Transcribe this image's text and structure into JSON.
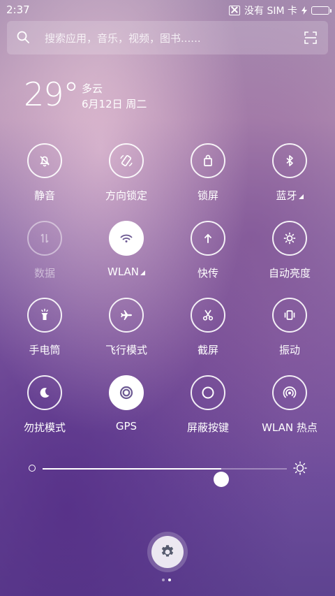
{
  "status": {
    "time": "2:37",
    "carrier": "没有 SIM 卡",
    "battery_percent": 100,
    "battery_color": "#3ddc44"
  },
  "search": {
    "placeholder": "搜索应用，音乐，视频，图书......"
  },
  "weather": {
    "temperature": "29°",
    "condition": "多云",
    "date": "6月12日 周二"
  },
  "toggles": [
    {
      "label": "静音",
      "icon": "silent-icon",
      "state": "off"
    },
    {
      "label": "方向锁定",
      "icon": "rotation-lock-icon",
      "state": "off"
    },
    {
      "label": "锁屏",
      "icon": "lock-icon",
      "state": "off"
    },
    {
      "label": "蓝牙",
      "icon": "bluetooth-icon",
      "state": "off",
      "expandable": true
    },
    {
      "label": "数据",
      "icon": "mobile-data-icon",
      "state": "disabled"
    },
    {
      "label": "WLAN",
      "icon": "wifi-icon",
      "state": "on",
      "expandable": true
    },
    {
      "label": "快传",
      "icon": "fast-transfer-icon",
      "state": "off"
    },
    {
      "label": "自动亮度",
      "icon": "auto-brightness-icon",
      "state": "off"
    },
    {
      "label": "手电筒",
      "icon": "flashlight-icon",
      "state": "off"
    },
    {
      "label": "飞行模式",
      "icon": "airplane-icon",
      "state": "off"
    },
    {
      "label": "截屏",
      "icon": "screenshot-icon",
      "state": "off"
    },
    {
      "label": "振动",
      "icon": "vibrate-icon",
      "state": "off"
    },
    {
      "label": "勿扰模式",
      "icon": "do-not-disturb-icon",
      "state": "off"
    },
    {
      "label": "GPS",
      "icon": "gps-icon",
      "state": "on"
    },
    {
      "label": "屏蔽按键",
      "icon": "block-keys-icon",
      "state": "off"
    },
    {
      "label": "WLAN 热点",
      "icon": "hotspot-icon",
      "state": "off"
    }
  ],
  "brightness": {
    "level": 0.73
  },
  "pager": {
    "pages": 2,
    "current": 2
  }
}
